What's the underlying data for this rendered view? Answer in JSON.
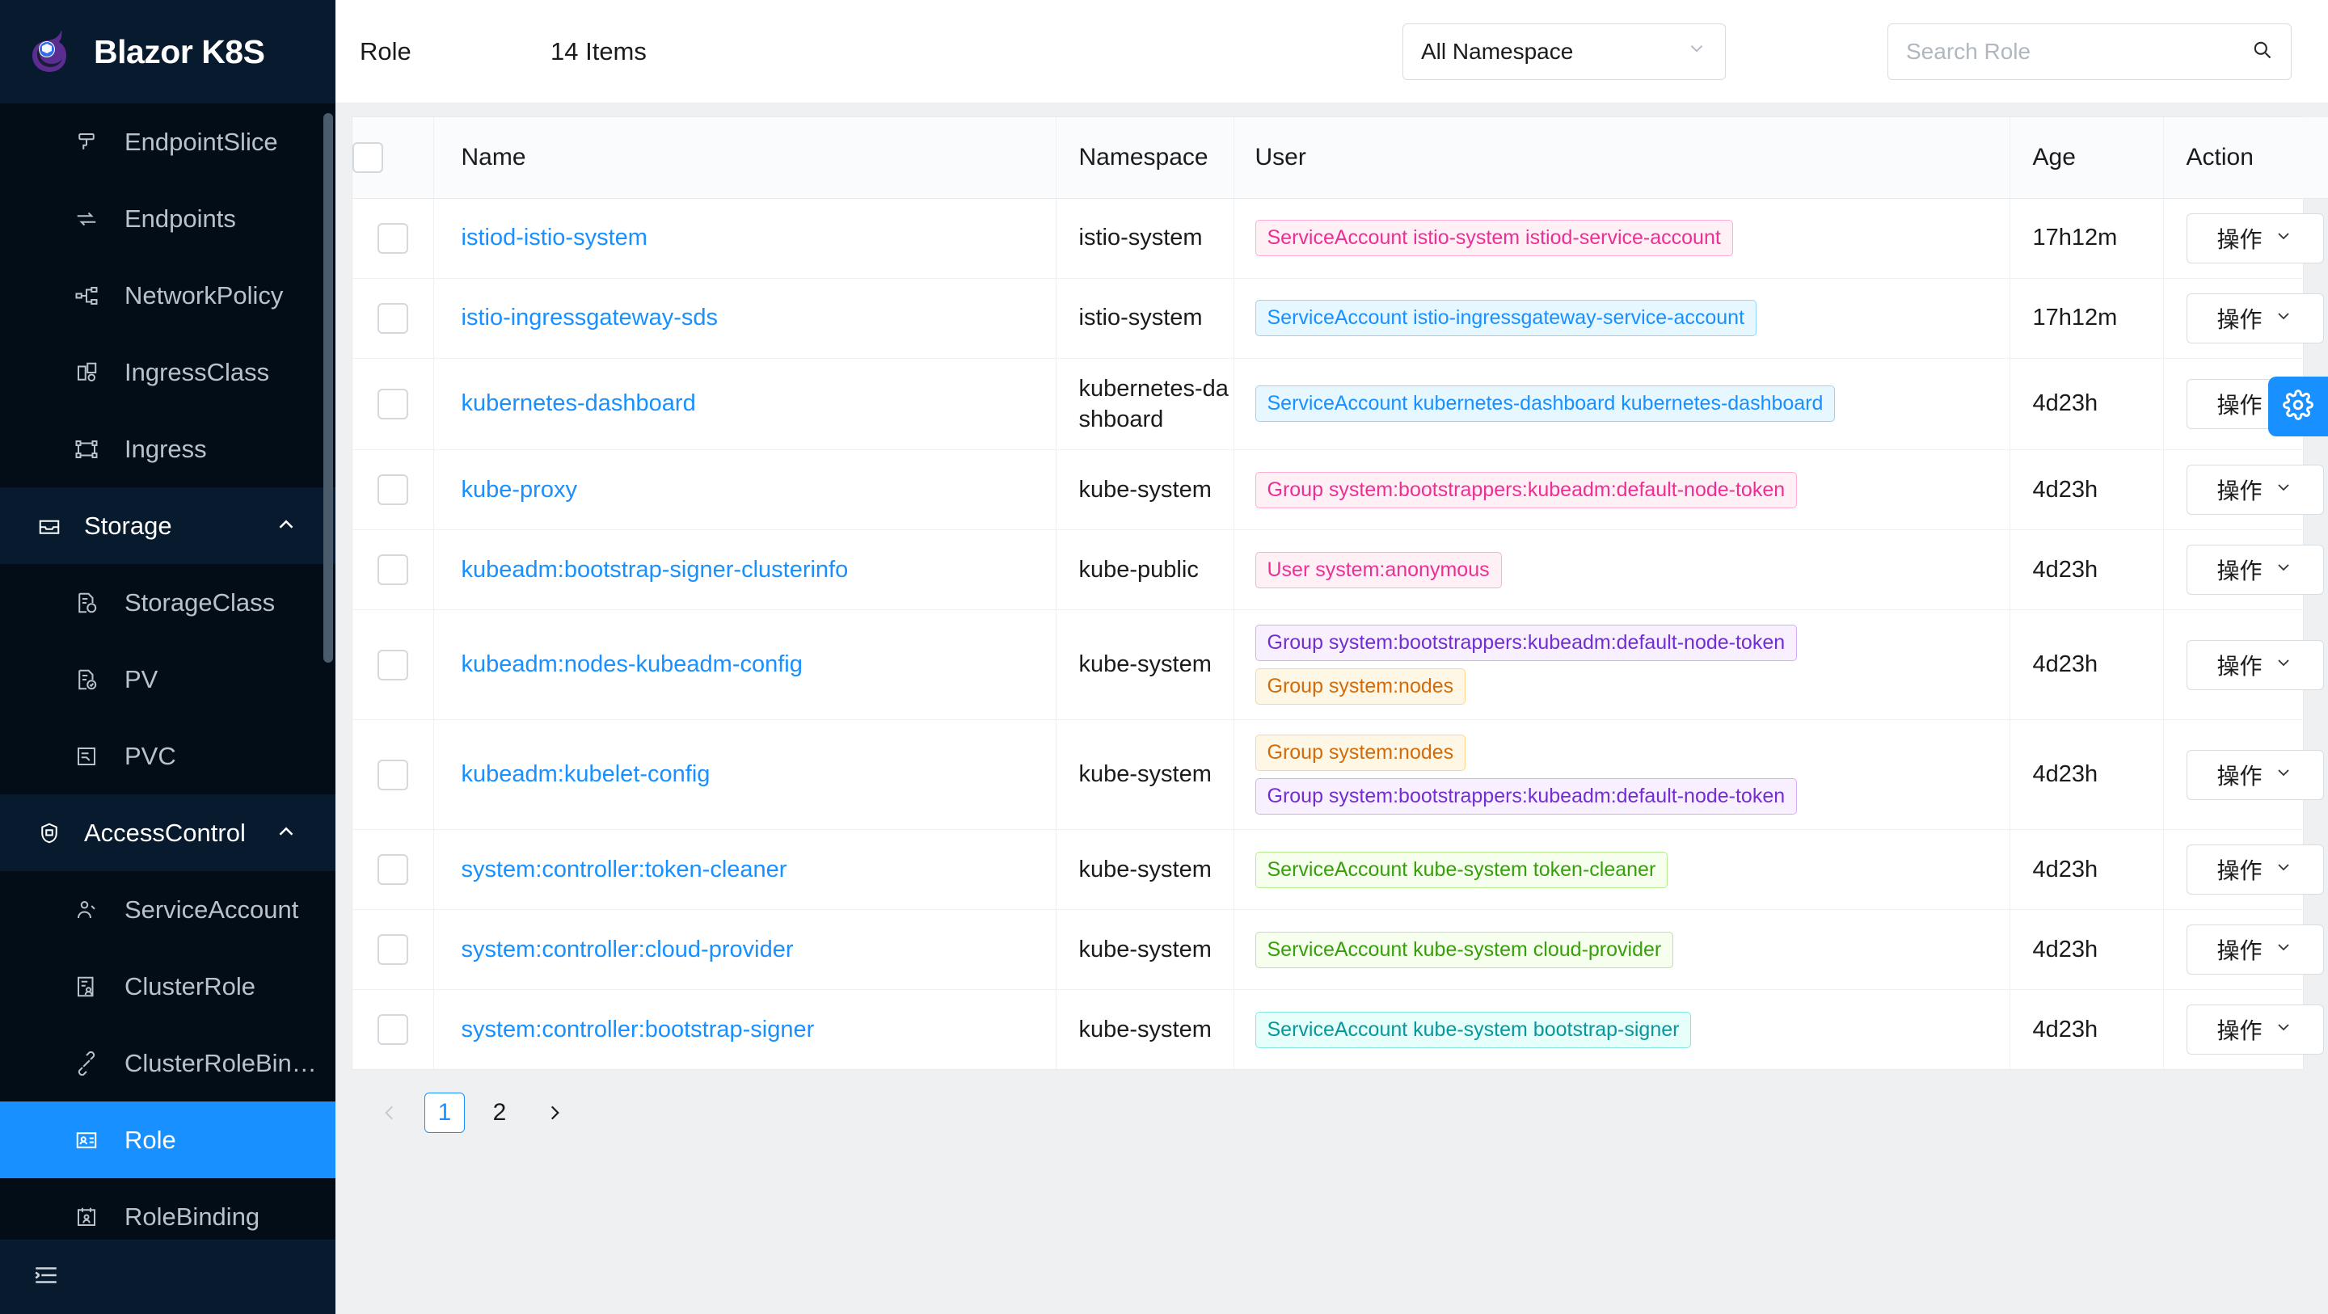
{
  "app": {
    "brand_title": "Blazor K8S"
  },
  "sidebar": {
    "items": [
      {
        "label": "EndpointSlice",
        "icon": "endpointslice-icon",
        "type": "item",
        "active": false
      },
      {
        "label": "Endpoints",
        "icon": "endpoints-icon",
        "type": "item",
        "active": false
      },
      {
        "label": "NetworkPolicy",
        "icon": "networkpolicy-icon",
        "type": "item",
        "active": false
      },
      {
        "label": "IngressClass",
        "icon": "ingressclass-icon",
        "type": "item",
        "active": false
      },
      {
        "label": "Ingress",
        "icon": "ingress-icon",
        "type": "item",
        "active": false
      },
      {
        "label": "Storage",
        "icon": "storage-icon",
        "type": "group",
        "expanded": true
      },
      {
        "label": "StorageClass",
        "icon": "storageclass-icon",
        "type": "item",
        "active": false
      },
      {
        "label": "PV",
        "icon": "pv-icon",
        "type": "item",
        "active": false
      },
      {
        "label": "PVC",
        "icon": "pvc-icon",
        "type": "item",
        "active": false
      },
      {
        "label": "AccessControl",
        "icon": "shield-icon",
        "type": "group",
        "expanded": true
      },
      {
        "label": "ServiceAccount",
        "icon": "serviceaccount-icon",
        "type": "item",
        "active": false
      },
      {
        "label": "ClusterRole",
        "icon": "clusterrole-icon",
        "type": "item",
        "active": false
      },
      {
        "label": "ClusterRoleBin…",
        "icon": "clusterrolebinding-icon",
        "type": "item",
        "active": false
      },
      {
        "label": "Role",
        "icon": "role-icon",
        "type": "item",
        "active": true
      },
      {
        "label": "RoleBinding",
        "icon": "rolebinding-icon",
        "type": "item",
        "active": false
      }
    ],
    "collapse_icon": "collapse-sidebar-icon"
  },
  "toolbar": {
    "title": "Role",
    "item_count": "14 Items",
    "namespace_value": "All Namespace",
    "namespace_caret": "chevron-down-icon",
    "search_placeholder": "Search Role",
    "search_value": "",
    "search_icon": "search-icon"
  },
  "table": {
    "columns": [
      "Name",
      "Namespace",
      "User",
      "Age",
      "Action"
    ],
    "action_label": "操作",
    "rows": [
      {
        "name": "istiod-istio-system",
        "namespace": "istio-system",
        "tags": [
          {
            "text": "ServiceAccount istio-system istiod-service-account",
            "color": "pink"
          }
        ],
        "age": "17h12m"
      },
      {
        "name": "istio-ingressgateway-sds",
        "namespace": "istio-system",
        "tags": [
          {
            "text": "ServiceAccount istio-ingressgateway-service-account",
            "color": "blue"
          }
        ],
        "age": "17h12m"
      },
      {
        "name": "kubernetes-dashboard",
        "namespace": "kubernetes-dashboard",
        "tags": [
          {
            "text": "ServiceAccount kubernetes-dashboard kubernetes-dashboard",
            "color": "blue"
          }
        ],
        "age": "4d23h"
      },
      {
        "name": "kube-proxy",
        "namespace": "kube-system",
        "tags": [
          {
            "text": "Group system:bootstrappers:kubeadm:default-node-token",
            "color": "pink"
          }
        ],
        "age": "4d23h"
      },
      {
        "name": "kubeadm:bootstrap-signer-clusterinfo",
        "namespace": "kube-public",
        "tags": [
          {
            "text": "User system:anonymous",
            "color": "pink"
          }
        ],
        "age": "4d23h"
      },
      {
        "name": "kubeadm:nodes-kubeadm-config",
        "namespace": "kube-system",
        "tags": [
          {
            "text": "Group system:bootstrappers:kubeadm:default-node-token",
            "color": "purple"
          },
          {
            "text": "Group system:nodes",
            "color": "orange"
          }
        ],
        "age": "4d23h"
      },
      {
        "name": "kubeadm:kubelet-config",
        "namespace": "kube-system",
        "tags": [
          {
            "text": "Group system:nodes",
            "color": "orange"
          },
          {
            "text": "Group system:bootstrappers:kubeadm:default-node-token",
            "color": "purple"
          }
        ],
        "age": "4d23h"
      },
      {
        "name": "system:controller:token-cleaner",
        "namespace": "kube-system",
        "tags": [
          {
            "text": "ServiceAccount kube-system token-cleaner",
            "color": "green"
          }
        ],
        "age": "4d23h"
      },
      {
        "name": "system:controller:cloud-provider",
        "namespace": "kube-system",
        "tags": [
          {
            "text": "ServiceAccount kube-system cloud-provider",
            "color": "green"
          }
        ],
        "age": "4d23h"
      },
      {
        "name": "system:controller:bootstrap-signer",
        "namespace": "kube-system",
        "tags": [
          {
            "text": "ServiceAccount kube-system bootstrap-signer",
            "color": "cyan"
          }
        ],
        "age": "4d23h"
      }
    ]
  },
  "pagination": {
    "prev": "‹",
    "next": "›",
    "pages": [
      "1",
      "2"
    ],
    "current": "1"
  },
  "floating": {
    "settings_icon": "gear-icon"
  },
  "colors": {
    "accent": "#1890ff",
    "sidebar_bg": "#030d18",
    "sidebar_group_bg": "#071a2e",
    "link": "#1890ff"
  }
}
